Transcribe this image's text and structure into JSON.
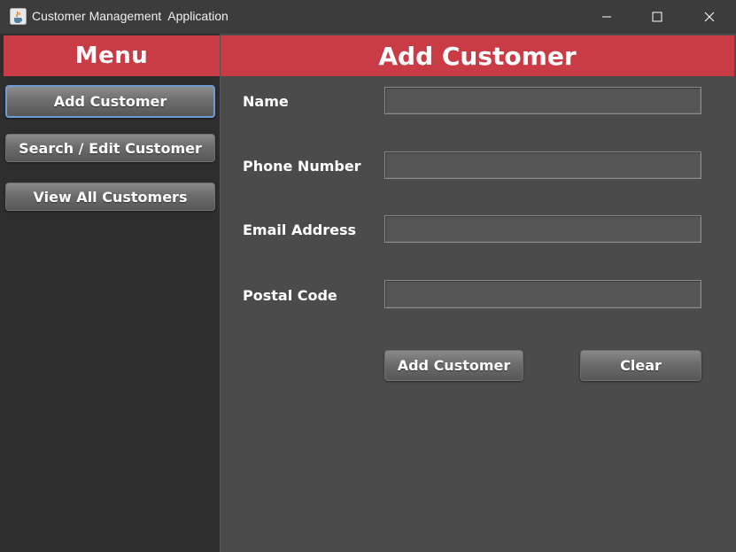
{
  "window": {
    "title": "Customer Management  Application",
    "icon": "java-cup-icon",
    "controls": [
      "minimize-icon",
      "maximize-icon",
      "close-icon"
    ]
  },
  "sidebar": {
    "header": "Menu",
    "items": [
      {
        "label": "Add Customer",
        "active": true
      },
      {
        "label": "Search / Edit Customer",
        "active": false
      },
      {
        "label": "View All Customers",
        "active": false
      }
    ]
  },
  "main": {
    "header": "Add Customer",
    "fields": [
      {
        "label": "Name",
        "value": ""
      },
      {
        "label": "Phone Number",
        "value": ""
      },
      {
        "label": "Email Address",
        "value": ""
      },
      {
        "label": "Postal Code",
        "value": ""
      }
    ],
    "buttons": {
      "add": "Add Customer",
      "clear": "Clear"
    }
  },
  "colors": {
    "accent": "#c93c45",
    "sidebar_bg": "#2e2e2e",
    "main_bg": "#4b4b4b",
    "titlebar_bg": "#3c3c3c",
    "active_border": "#6f9bd6"
  }
}
